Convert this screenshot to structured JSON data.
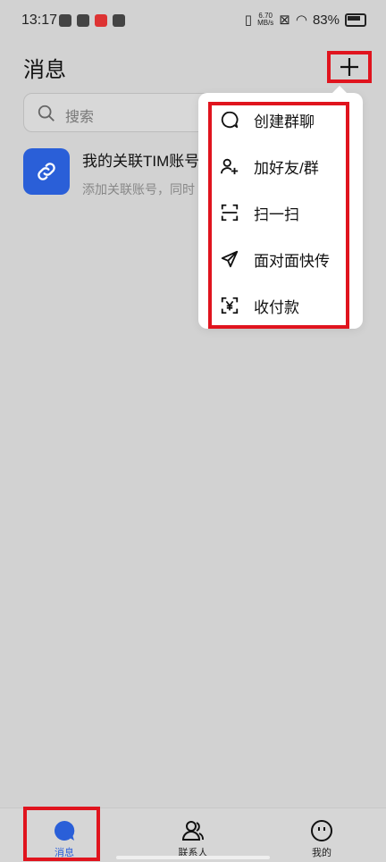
{
  "status": {
    "time": "13:17",
    "speed_value": "6.70",
    "speed_unit": "MB/s",
    "battery": "83%"
  },
  "header": {
    "title": "消息",
    "add_icon": "plus-icon"
  },
  "search": {
    "placeholder": "搜索"
  },
  "conversation": {
    "title": "我的关联TIM账号",
    "subtitle": "添加关联账号，同时"
  },
  "menu": {
    "items": [
      {
        "label": "创建群聊",
        "icon": "chat-bubble-icon"
      },
      {
        "label": "加好友/群",
        "icon": "add-person-icon"
      },
      {
        "label": "扫一扫",
        "icon": "scan-icon"
      },
      {
        "label": "面对面快传",
        "icon": "send-icon"
      },
      {
        "label": "收付款",
        "icon": "payment-icon"
      }
    ]
  },
  "tabs": [
    {
      "label": "消息",
      "active": true
    },
    {
      "label": "联系人",
      "active": false
    },
    {
      "label": "我的",
      "active": false
    }
  ],
  "colors": {
    "accent": "#2a5fd8",
    "highlight": "#e0141e",
    "background": "#d2d2d2"
  }
}
